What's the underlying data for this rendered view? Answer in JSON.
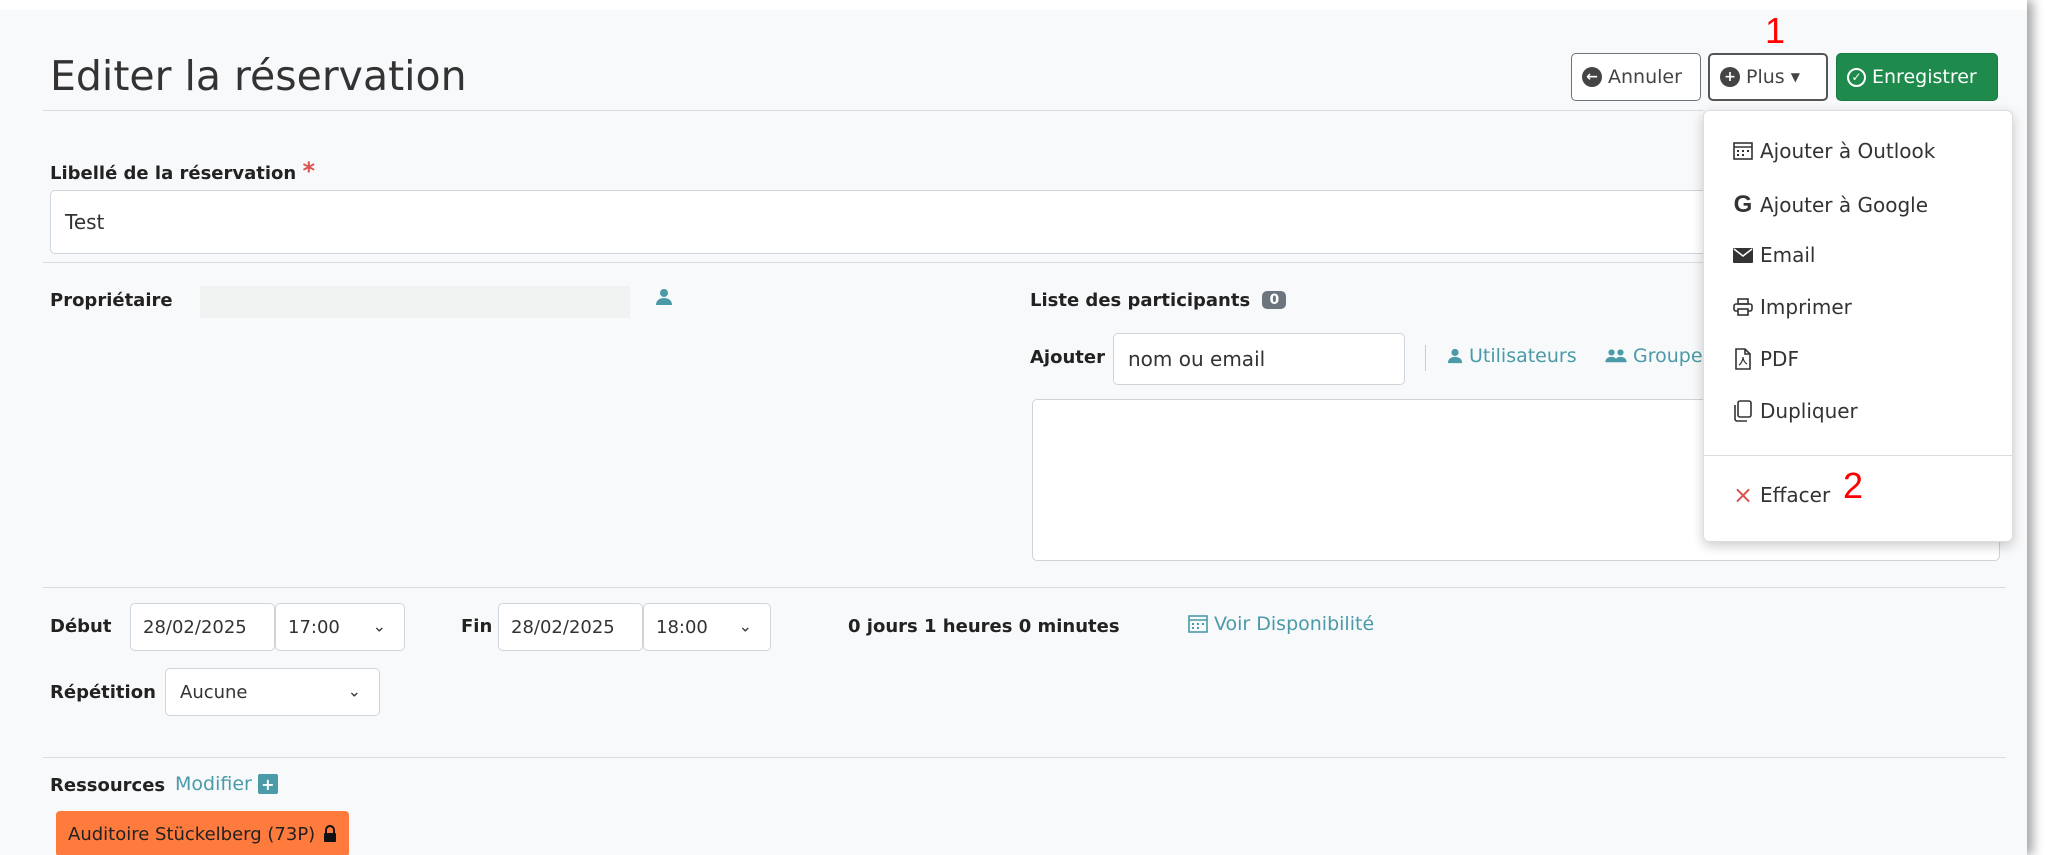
{
  "page": {
    "title": "Editer la réservation"
  },
  "toolbar": {
    "cancel_label": "Annuler",
    "more_label": "Plus",
    "save_label": "Enregistrer"
  },
  "menu": {
    "items": [
      {
        "label": "Ajouter à Outlook",
        "icon": "calendar-icon"
      },
      {
        "label": "Ajouter à Google",
        "icon": "google-icon"
      },
      {
        "label": "Email",
        "icon": "envelope-icon"
      },
      {
        "label": "Imprimer",
        "icon": "printer-icon"
      },
      {
        "label": "PDF",
        "icon": "pdf-icon"
      },
      {
        "label": "Dupliquer",
        "icon": "copy-icon"
      }
    ],
    "delete_label": "Effacer"
  },
  "annotations": {
    "one": "1",
    "two": "2"
  },
  "form": {
    "name_label": "Libellé de la réservation",
    "required_mark": "*",
    "name_value": "Test",
    "owner_label": "Propriétaire",
    "participants_label": "Liste des participants",
    "participants_count": "0",
    "add_label": "Ajouter",
    "add_placeholder": "nom ou email",
    "users_link": "Utilisateurs",
    "groups_link": "Groupe",
    "start_label": "Début",
    "start_date": "28/02/2025",
    "start_time": "17:00",
    "end_label": "Fin",
    "end_date": "28/02/2025",
    "end_time": "18:00",
    "duration": "0 jours 1 heures 0 minutes",
    "availability_link": "Voir Disponibilité",
    "repeat_label": "Répétition",
    "repeat_value": "Aucune",
    "resources_label": "Ressources",
    "modify_link": "Modifier",
    "resource_item": "Auditoire Stückelberg (73P)"
  },
  "colors": {
    "save_green": "#1e8a4c",
    "resource_orange": "#ff7a3d",
    "link_teal": "#4a9aa8",
    "delete_red": "#d9534f"
  }
}
